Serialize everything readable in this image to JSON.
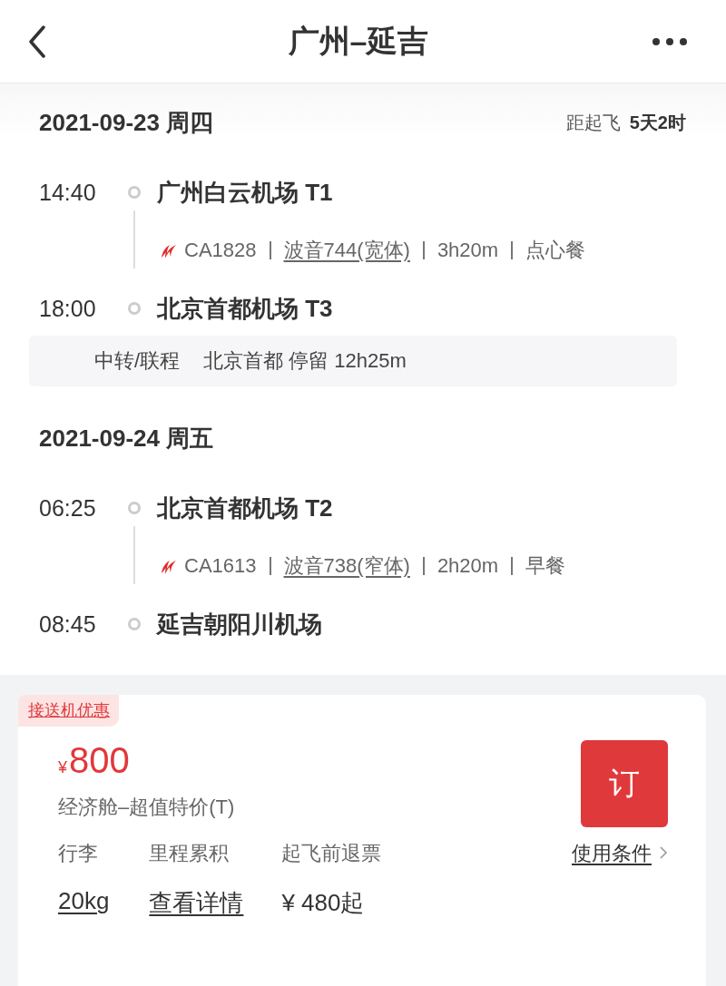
{
  "header": {
    "title": "广州–延吉"
  },
  "itinerary": [
    {
      "kind": "date",
      "date": "2021-09-23 周四",
      "countdown": {
        "label": "距起飞",
        "value": "5天2时"
      }
    },
    {
      "kind": "flight",
      "departure": {
        "time": "14:40",
        "airport": "广州白云机场 T1"
      },
      "flight_no": "CA1828",
      "aircraft": "波音744(宽体)",
      "duration": "3h20m",
      "meal": "点心餐",
      "arrival": {
        "time": "18:00",
        "airport": "北京首都机场 T3"
      }
    },
    {
      "kind": "transfer",
      "label": "中转/联程",
      "detail": "北京首都 停留 12h25m"
    },
    {
      "kind": "date",
      "date": "2021-09-24 周五"
    },
    {
      "kind": "flight",
      "departure": {
        "time": "06:25",
        "airport": "北京首都机场 T2"
      },
      "flight_no": "CA1613",
      "aircraft": "波音738(窄体)",
      "duration": "2h20m",
      "meal": "早餐",
      "arrival": {
        "time": "08:45",
        "airport": "延吉朝阳川机场"
      }
    }
  ],
  "fare": {
    "tag": "接送机优惠",
    "currency": "¥",
    "price": "800",
    "cabin": "经济舱–超值特价(T)",
    "book_button": "订",
    "details": [
      {
        "label": "行李",
        "value": "20kg",
        "link": true
      },
      {
        "label": "里程累积",
        "value": "查看详情",
        "link": true
      },
      {
        "label": "起飞前退票",
        "value": "¥ 480起",
        "link": false
      }
    ],
    "conditions_link": "使用条件"
  }
}
